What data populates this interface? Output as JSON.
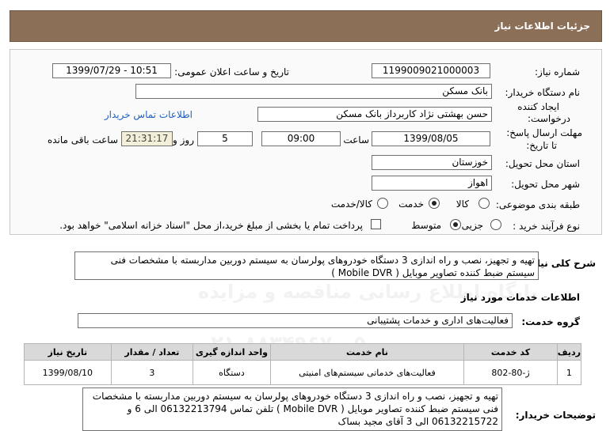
{
  "header": {
    "title": "جزئیات اطلاعات نیاز"
  },
  "need": {
    "number_label": "شماره نیاز:",
    "number_value": "1199009021000003",
    "announce_label": "تاریخ و ساعت اعلان عمومی:",
    "announce_value": "1399/07/29 - 10:51",
    "buyer_label": "نام دستگاه خریدار:",
    "buyer_value": "بانک مسکن",
    "creator_label_1": "ایجاد کننده",
    "creator_label_2": "درخواست:",
    "creator_value": "حسن بهشتی نژاد کاربرداز بانک مسکن",
    "contact_link": "اطلاعات تماس خریدار",
    "deadline_label_1": "مهلت ارسال پاسخ:",
    "deadline_label_2": "تا تاریخ:",
    "deadline_date": "1399/08/05",
    "time_label": "ساعت",
    "deadline_time": "09:00",
    "days_value": "5",
    "days_label": "روز و",
    "remaining_value": "21:31:17",
    "remaining_label": "ساعت باقی مانده",
    "province_label": "استان محل تحویل:",
    "province_value": "خوزستان",
    "city_label": "شهر محل تحویل:",
    "city_value": "اهواز",
    "category_label": "طبقه بندی موضوعی:",
    "category_options": [
      "کالا",
      "خدمت",
      "کالا/خدمت"
    ],
    "category_selected": "خدمت",
    "process_label": "نوع فرآیند خرید :",
    "process_options": [
      "جزیی",
      "متوسط"
    ],
    "process_selected": "متوسط",
    "payment_note": "پرداخت تمام یا بخشی از مبلغ خرید،از محل \"اسناد خزانه اسلامی\" خواهد بود."
  },
  "summary": {
    "label": "شرح کلی نیاز:",
    "line1": "تهیه و تجهیز، نصب و راه اندازی  3 دستگاه خودروهای پولرسان به سیستم دوربین مداربسته با مشخصات فنی",
    "line2": "سیستم ضبط کننده تصاویر موبایل  (  Mobile DVR  )"
  },
  "services": {
    "title": "اطلاعات خدمات مورد نیاز",
    "group_label": "گروه خدمت:",
    "group_value": "فعالیت‌های اداری و خدمات پشتیبانی",
    "columns": [
      "ردیف",
      "کد خدمت",
      "نام خدمت",
      "واحد اندازه گیری",
      "تعداد / مقدار",
      "تاریخ نیاز"
    ],
    "rows": [
      [
        "1",
        "ژ-80-802",
        "فعالیت‌های خدماتی سیستم‌های امنیتی",
        "دستگاه",
        "3",
        "1399/08/10"
      ]
    ]
  },
  "buyer_notes": {
    "label": "توضیحات خریدار:",
    "line1": "تهیه و تجهیز، نصب و راه اندازی  3 دستگاه خودروهای پولرسان به سیستم دوربین مداربسته با مشخصات",
    "line2": "فنی سیستم ضبط کننده تصاویر موبایل  (  Mobile DVR  ) تلفن تماس 06132213794 الی 6 و",
    "line3": "06132215722 الی 3 آقای مجید بساک"
  },
  "watermark": {
    "line1": "ParsNamadData",
    "line2": "پایگاه اطلاع رسانی مناقصه و مزایده",
    "line3": "۰۲۱-۸۸۳۴۹۶۷۰-۵"
  },
  "colors": {
    "header_bg": "#8b6f57",
    "link": "#1f5fbf",
    "remaining_bg": "#f3efd9"
  }
}
